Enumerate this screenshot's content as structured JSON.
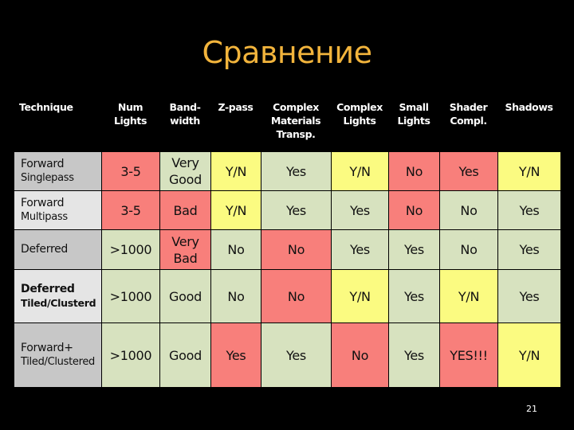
{
  "slide": {
    "title": "Сравнение",
    "page_number": "21"
  },
  "colors": {
    "title": "#f2b43c",
    "good": "#d7e2bf",
    "bad": "#f87f7b",
    "partial": "#fbfb81",
    "row_header_dark": "#c7c7c7",
    "row_header_light": "#e5e5e5"
  },
  "table": {
    "headers": [
      "Technique",
      "Num\nLights",
      "Band-\nwidth",
      "Z-pass",
      "Complex\nMaterials\nTransp.",
      "Complex\nLights",
      "Small\nLights",
      "Shader\nCompl.",
      "Shadows"
    ],
    "rows": [
      {
        "technique": [
          "Forward",
          "Singlepass"
        ],
        "cells": [
          {
            "text": "3-5",
            "rating": "bad"
          },
          {
            "text": "Very\nGood",
            "rating": "good"
          },
          {
            "text": "Y/N",
            "rating": "partial"
          },
          {
            "text": "Yes",
            "rating": "good"
          },
          {
            "text": "Y/N",
            "rating": "partial"
          },
          {
            "text": "No",
            "rating": "bad"
          },
          {
            "text": "Yes",
            "rating": "bad"
          },
          {
            "text": "Y/N",
            "rating": "partial"
          }
        ]
      },
      {
        "technique": [
          "Forward",
          "Multipass"
        ],
        "cells": [
          {
            "text": "3-5",
            "rating": "bad"
          },
          {
            "text": "Bad",
            "rating": "bad"
          },
          {
            "text": "Y/N",
            "rating": "partial"
          },
          {
            "text": "Yes",
            "rating": "good"
          },
          {
            "text": "Yes",
            "rating": "good"
          },
          {
            "text": "No",
            "rating": "bad"
          },
          {
            "text": "No",
            "rating": "good"
          },
          {
            "text": "Yes",
            "rating": "good"
          }
        ]
      },
      {
        "technique": [
          "Deferred",
          ""
        ],
        "cells": [
          {
            "text": ">1000",
            "rating": "good"
          },
          {
            "text": "Very\nBad",
            "rating": "bad"
          },
          {
            "text": "No",
            "rating": "good"
          },
          {
            "text": "No",
            "rating": "bad"
          },
          {
            "text": "Yes",
            "rating": "good"
          },
          {
            "text": "Yes",
            "rating": "good"
          },
          {
            "text": "No",
            "rating": "good"
          },
          {
            "text": "Yes",
            "rating": "good"
          }
        ]
      },
      {
        "technique": [
          "Deferred",
          "Tiled/Clusterd"
        ],
        "bold": true,
        "cells": [
          {
            "text": ">1000",
            "rating": "good"
          },
          {
            "text": "Good",
            "rating": "good"
          },
          {
            "text": "No",
            "rating": "good"
          },
          {
            "text": "No",
            "rating": "bad"
          },
          {
            "text": "Y/N",
            "rating": "partial"
          },
          {
            "text": "Yes",
            "rating": "good"
          },
          {
            "text": "Y/N",
            "rating": "partial"
          },
          {
            "text": "Yes",
            "rating": "good"
          }
        ]
      },
      {
        "technique": [
          "Forward+",
          "Tiled/Clustered"
        ],
        "cells": [
          {
            "text": ">1000",
            "rating": "good"
          },
          {
            "text": "Good",
            "rating": "good"
          },
          {
            "text": "Yes",
            "rating": "bad"
          },
          {
            "text": "Yes",
            "rating": "good"
          },
          {
            "text": "No",
            "rating": "bad"
          },
          {
            "text": "Yes",
            "rating": "good"
          },
          {
            "text": "YES!!!",
            "rating": "bad"
          },
          {
            "text": "Y/N",
            "rating": "partial"
          }
        ]
      }
    ]
  }
}
